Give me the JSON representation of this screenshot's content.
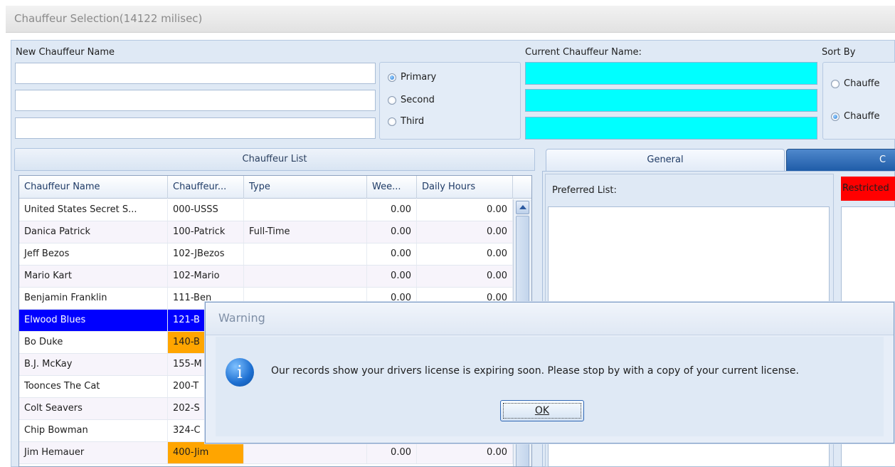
{
  "window": {
    "title": "Chauffeur Selection(14122 milisec)"
  },
  "form": {
    "new_name_label": "New Chauffeur Name",
    "current_name_label": "Current Chauffeur Name:",
    "sort_by_label": "Sort By",
    "priority_options": [
      "Primary",
      "Second",
      "Third"
    ],
    "priority_selected": "Primary",
    "sort_options": [
      "Chauffe",
      "Chauffe"
    ],
    "sort_selected_index": 1
  },
  "list": {
    "header": "Chauffeur List",
    "columns": [
      "Chauffeur Name",
      "Chauffeur...",
      "Type",
      "Wee...",
      "Daily Hours"
    ],
    "rows": [
      {
        "name": "United States Secret S...",
        "code": "000-USSS",
        "type": "",
        "week": "0.00",
        "daily": "0.00"
      },
      {
        "name": "Danica Patrick",
        "code": "100-Patrick",
        "type": "Full-Time",
        "week": "0.00",
        "daily": "0.00"
      },
      {
        "name": "Jeff Bezos",
        "code": "102-JBezos",
        "type": "",
        "week": "0.00",
        "daily": "0.00"
      },
      {
        "name": "Mario Kart",
        "code": "102-Mario",
        "type": "",
        "week": "0.00",
        "daily": "0.00"
      },
      {
        "name": "Benjamin Franklin",
        "code": "111-Ben",
        "type": "",
        "week": "0.00",
        "daily": "0.00"
      },
      {
        "name": "Elwood Blues",
        "code": "121-B",
        "type": "",
        "week": "",
        "daily": ""
      },
      {
        "name": "Bo Duke",
        "code": "140-B",
        "type": "",
        "week": "",
        "daily": ""
      },
      {
        "name": "B.J. McKay",
        "code": "155-M",
        "type": "",
        "week": "",
        "daily": ""
      },
      {
        "name": "Toonces The Cat",
        "code": "200-T",
        "type": "",
        "week": "",
        "daily": ""
      },
      {
        "name": "Colt Seavers",
        "code": "202-S",
        "type": "",
        "week": "",
        "daily": ""
      },
      {
        "name": "Chip Bowman",
        "code": "324-C",
        "type": "",
        "week": "",
        "daily": ""
      },
      {
        "name": "Jim Hemauer",
        "code": "400-Jim",
        "type": "",
        "week": "0.00",
        "daily": "0.00"
      }
    ]
  },
  "tabs": {
    "general": "General",
    "other": "C"
  },
  "general": {
    "preferred_label": "Preferred List:",
    "restricted_label": "Restricted"
  },
  "dialog": {
    "title": "Warning",
    "message": "Our records show your drivers license is expiring soon.  Please stop by with a copy of your current license.",
    "ok_label": "OK"
  },
  "colors": {
    "selected_row": "#0000ff",
    "highlight_code": "#ffa500",
    "current_name_fill": "#00ffff",
    "restricted": "#ff0000"
  }
}
